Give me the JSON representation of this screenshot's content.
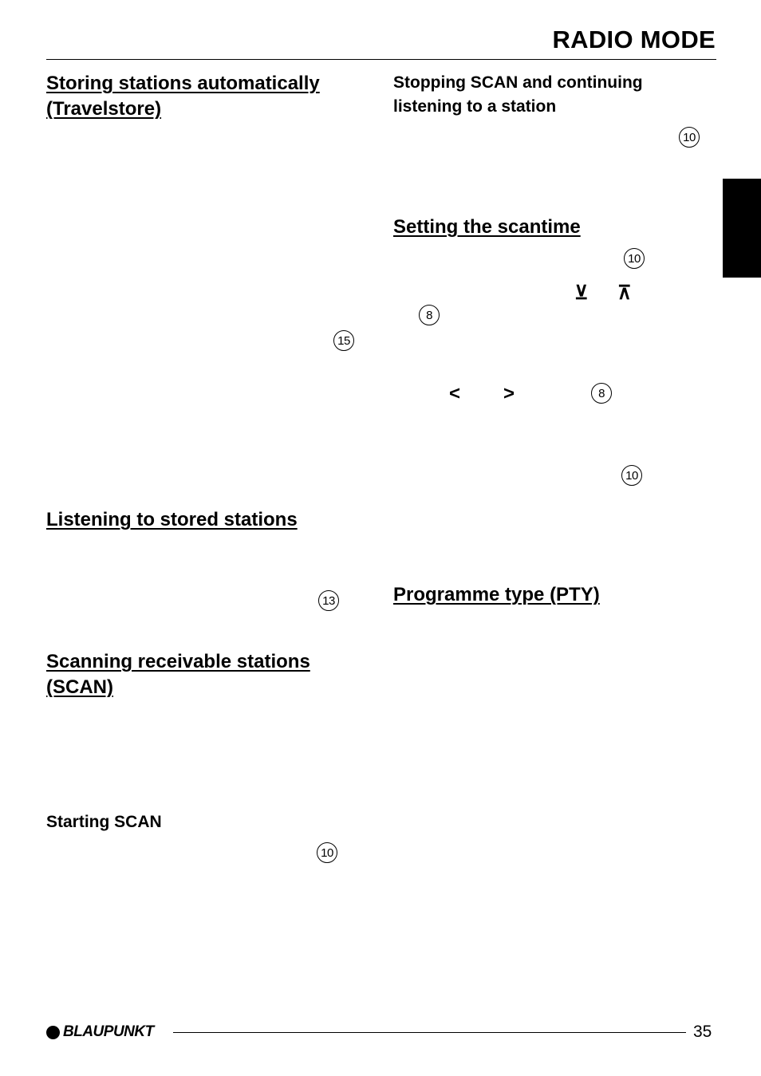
{
  "header": {
    "title": "RADIO MODE"
  },
  "left_column": {
    "travelstore": {
      "heading": "Storing stations automatically (Travelstore)",
      "button_ref": "15"
    },
    "listening_stored": {
      "heading": "Listening to stored stations",
      "button_ref": "13"
    },
    "scan": {
      "heading": "Scanning receivable stations (SCAN)",
      "starting_scan": {
        "subheading": "Starting SCAN",
        "button_ref": "10"
      }
    }
  },
  "right_column": {
    "stopping_scan": {
      "subheading": "Stopping SCAN and continuing listening to a station",
      "button_ref": "10"
    },
    "scantime": {
      "heading": "Setting the scantime",
      "button_ref_1": "10",
      "down_symbol": "⊻",
      "up_symbol": "⊼",
      "button_ref_2": "8",
      "left_symbol": "<",
      "right_symbol": ">",
      "button_ref_3": "8",
      "button_ref_4": "10"
    },
    "pty": {
      "heading": "Programme type (PTY)"
    }
  },
  "footer": {
    "brand": "BLAUPUNKT",
    "page_number": "35"
  }
}
